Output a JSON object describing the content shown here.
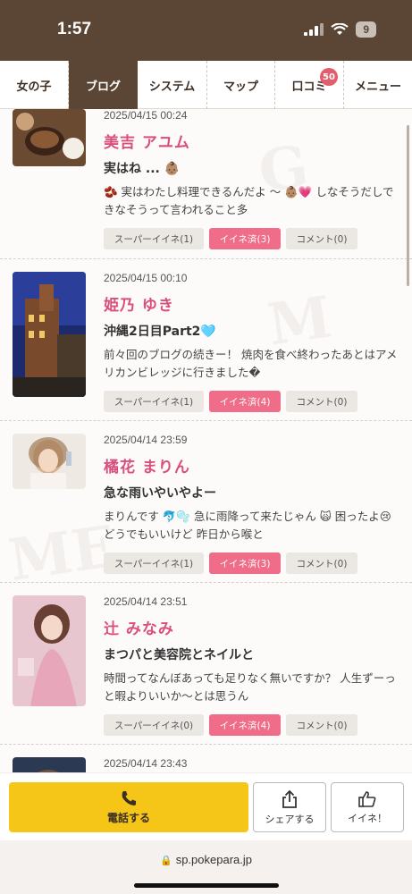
{
  "status": {
    "time": "1:57",
    "battery": "9"
  },
  "nav": {
    "tabs": [
      {
        "label": "女の子"
      },
      {
        "label": "ブログ"
      },
      {
        "label": "システム"
      },
      {
        "label": "マップ"
      },
      {
        "label": "口コミ",
        "badge": "50"
      },
      {
        "label": "メニュー"
      }
    ]
  },
  "posts": [
    {
      "date": "2025/04/15 00:24",
      "name": "美吉 アユム",
      "title": "実はね ... 👶🏽",
      "excerpt": "🫘 実はわたし料理できるんだよ ～ 👶🏽💗 しなそうだしできなそうって言われること多",
      "super_like": "スーパーイイネ(1)",
      "liked": "イイネ済(3)",
      "comment": "コメント(0)"
    },
    {
      "date": "2025/04/15 00:10",
      "name": "姫乃 ゆき",
      "title": "沖縄2日目Part2🩵",
      "excerpt": "前々回のブログの続きー！ 焼肉を食べ終わったあとはアメリカンビレッジに行きました�",
      "super_like": "スーパーイイネ(1)",
      "liked": "イイネ済(4)",
      "comment": "コメント(0)"
    },
    {
      "date": "2025/04/14 23:59",
      "name": "橘花 まりん",
      "title": "急な雨いやいやよー",
      "excerpt": "まりんです 🐬🫧 急に雨降って来たじゃん 🙀 困ったよ😢 どうでもいいけど 昨日から喉と",
      "super_like": "スーパーイイネ(1)",
      "liked": "イイネ済(3)",
      "comment": "コメント(0)"
    },
    {
      "date": "2025/04/14 23:51",
      "name": "辻 みなみ",
      "title": "まつパと美容院とネイルと",
      "excerpt": "時間ってなんぼあっても足りなく無いですか？ 人生ずーっと暇よりいいか～とは思うん",
      "super_like": "スーパーイイネ(0)",
      "liked": "イイネ済(4)",
      "comment": "コメント(0)"
    },
    {
      "date": "2025/04/14 23:43"
    }
  ],
  "bottom": {
    "call": "電話する",
    "share": "シェアする",
    "like": "イイネ！"
  },
  "url": "sp.pokepara.jp",
  "colors": {
    "brand_brown": "#5b4636",
    "pink": "#ef6d88",
    "name_pink": "#d94f7e",
    "call_yellow": "#f5c518"
  }
}
